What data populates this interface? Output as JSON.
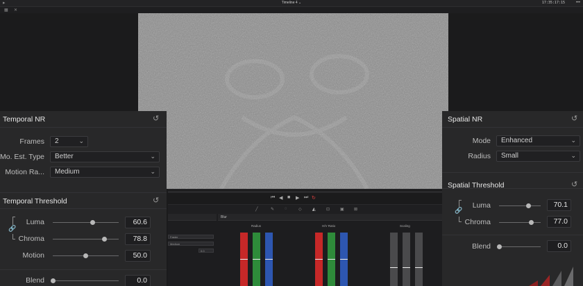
{
  "topbar": {
    "timeline_title": "Timeline 4 ⌄",
    "timecode": "17:35:17:15",
    "menu": "•••"
  },
  "temporal_nr": {
    "title": "Temporal NR",
    "frames": {
      "label": "Frames",
      "value": "2"
    },
    "mo_est_type": {
      "label": "Mo. Est. Type",
      "value": "Better"
    },
    "motion_range": {
      "label": "Motion Ra...",
      "value": "Medium"
    }
  },
  "temporal_threshold": {
    "title": "Temporal Threshold",
    "luma": {
      "label": "Luma",
      "value": "60.6",
      "level": 0.6
    },
    "chroma": {
      "label": "Chroma",
      "value": "78.8",
      "level": 0.788
    },
    "motion": {
      "label": "Motion",
      "value": "50.0",
      "level": 0.5
    },
    "blend": {
      "label": "Blend",
      "value": "0.0",
      "level": 0.0
    }
  },
  "spatial_nr": {
    "title": "Spatial NR",
    "mode": {
      "label": "Mode",
      "value": "Enhanced"
    },
    "radius": {
      "label": "Radius",
      "value": "Small"
    }
  },
  "spatial_threshold": {
    "title": "Spatial Threshold",
    "luma": {
      "label": "Luma",
      "value": "70.1",
      "level": 0.701
    },
    "chroma": {
      "label": "Chroma",
      "value": "77.0",
      "level": 0.77
    },
    "blend": {
      "label": "Blend",
      "value": "0.0",
      "level": 0.0
    }
  },
  "lower_panel": {
    "blur_tab": "Blur",
    "radius_label": "Radius",
    "hv_ratio_label": "H/V Ratio",
    "scaling_label": "Scaling",
    "mini_fields": [
      "Faster",
      "Medium"
    ],
    "mini_value": "0.0"
  },
  "colors": {
    "red": "#c62828",
    "green": "#2e8b3a",
    "blue": "#2d56b0",
    "loop": "#e04040"
  }
}
